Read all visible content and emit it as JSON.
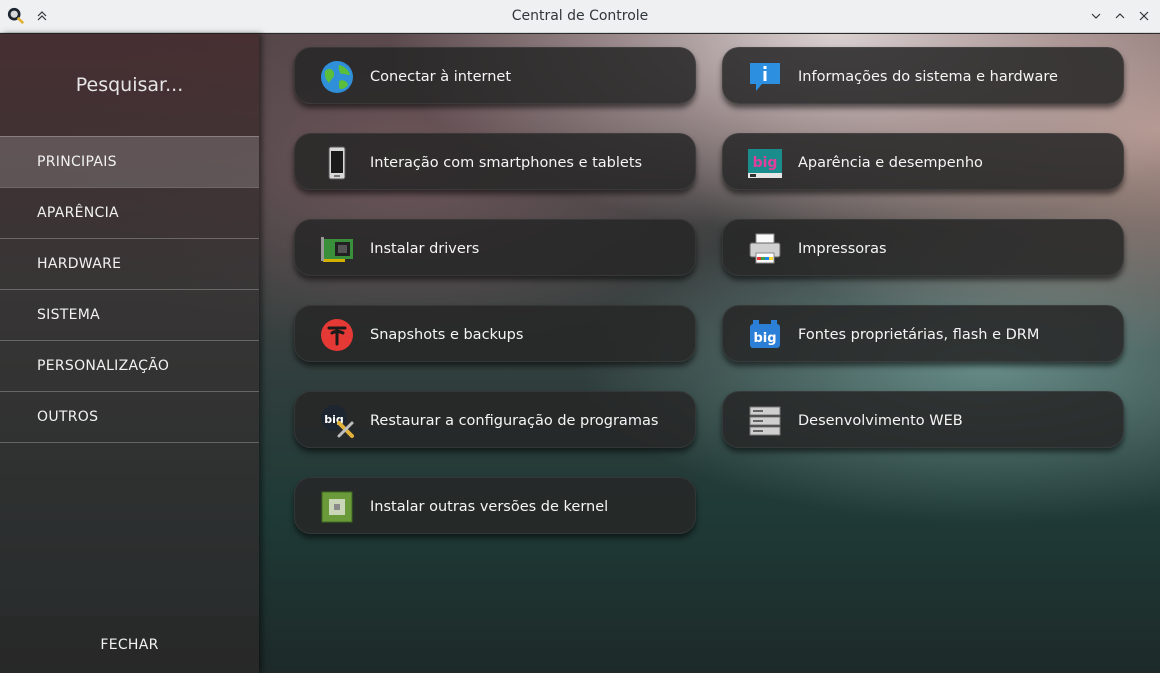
{
  "window": {
    "title": "Central de Controle"
  },
  "sidebar": {
    "search_placeholder": "Pesquisar...",
    "items": [
      {
        "label": "PRINCIPAIS",
        "active": true
      },
      {
        "label": "APARÊNCIA",
        "active": false
      },
      {
        "label": "HARDWARE",
        "active": false
      },
      {
        "label": "SISTEMA",
        "active": false
      },
      {
        "label": "PERSONALIZAÇÃO",
        "active": false
      },
      {
        "label": "OUTROS",
        "active": false
      }
    ],
    "close_label": "FECHAR"
  },
  "cards": [
    {
      "label": "Conectar à internet",
      "icon": "globe-icon"
    },
    {
      "label": "Informações do sistema e hardware",
      "icon": "info-icon"
    },
    {
      "label": "Interação com smartphones e tablets",
      "icon": "smartphone-icon"
    },
    {
      "label": "Aparência e desempenho",
      "icon": "big-appearance-icon"
    },
    {
      "label": "Instalar drivers",
      "icon": "graphics-card-icon"
    },
    {
      "label": "Impressoras",
      "icon": "printer-icon"
    },
    {
      "label": "Snapshots e backups",
      "icon": "timeshift-icon"
    },
    {
      "label": "Fontes proprietárias, flash e DRM",
      "icon": "big-codecs-icon"
    },
    {
      "label": "Restaurar a configuração de programas",
      "icon": "big-tools-icon"
    },
    {
      "label": "Desenvolvimento WEB",
      "icon": "server-icon"
    },
    {
      "label": "Instalar outras versões de kernel",
      "icon": "chip-icon"
    }
  ]
}
